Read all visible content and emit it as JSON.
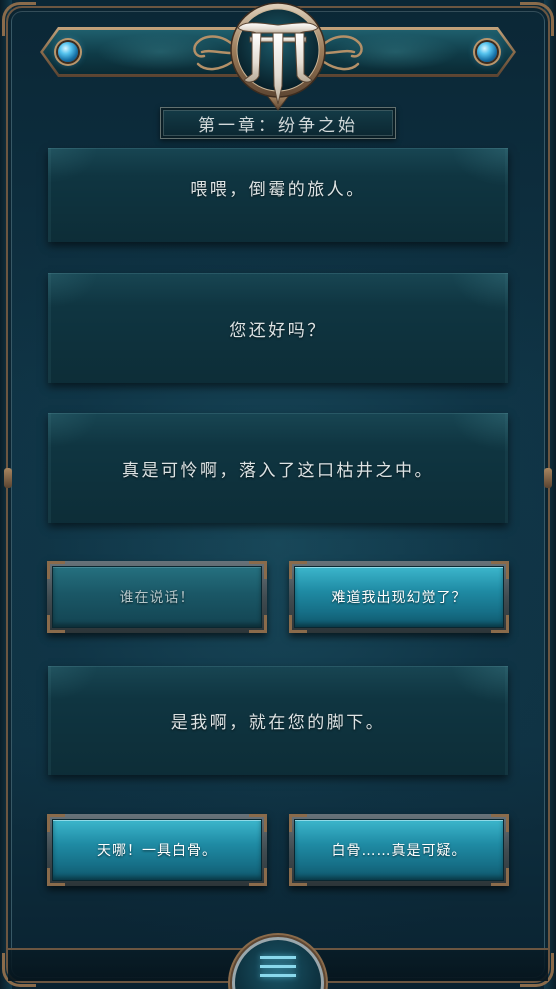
{
  "colors": {
    "background": "#0f3344",
    "panel": "#0f3541",
    "button_active": "#1f8ba4",
    "button_inactive": "#1a5766",
    "frame_bronze": "#8a6b4b",
    "text": "#dde3e4"
  },
  "header": {
    "logo_icon": "game-logo-emblem",
    "gem_icon": "blue-gem-icon",
    "chapter_title": "第一章：纷争之始"
  },
  "dialogue": [
    {
      "text": "喂喂，倒霉的旅人。"
    },
    {
      "text": "您还好吗？"
    },
    {
      "text": "真是可怜啊，落入了这口枯井之中。"
    },
    {
      "text": "是我啊，就在您的脚下。"
    }
  ],
  "choice_groups": [
    {
      "options": [
        {
          "label": "谁在说话！",
          "dimmed": true
        },
        {
          "label": "难道我出现幻觉了？",
          "dimmed": false
        }
      ]
    },
    {
      "options": [
        {
          "label": "天哪！一具白骨。",
          "dimmed": false
        },
        {
          "label": "白骨……真是可疑。",
          "dimmed": false
        }
      ]
    }
  ],
  "menu": {
    "icon": "hamburger-menu-icon"
  }
}
